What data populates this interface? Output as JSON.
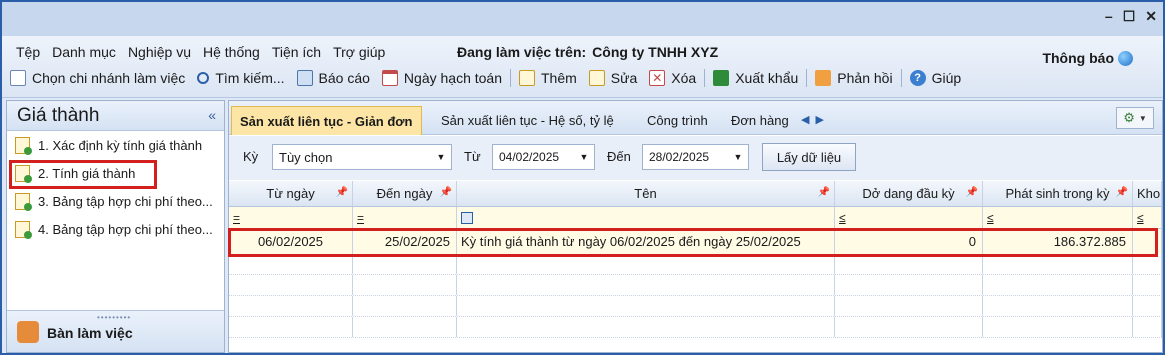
{
  "window": {
    "controls": [
      "–",
      "☐",
      "✕"
    ]
  },
  "menu": {
    "items": [
      "Tệp",
      "Danh mục",
      "Nghiệp vụ",
      "Hệ thống",
      "Tiện ích",
      "Trợ giúp"
    ],
    "working_on_label": "Đang làm việc trên:",
    "company": "Công ty TNHH XYZ",
    "notification": "Thông báo"
  },
  "toolbar": {
    "branch": "Chọn chi nhánh làm việc",
    "search": "Tìm kiếm...",
    "report": "Báo cáo",
    "accounting_date": "Ngày hạch toán",
    "add": "Thêm",
    "edit": "Sửa",
    "delete": "Xóa",
    "export": "Xuất khẩu",
    "feedback": "Phản hồi",
    "help": "Giúp"
  },
  "sidebar": {
    "title": "Giá thành",
    "collapse": "«",
    "items": [
      {
        "label": "1. Xác định kỳ tính giá thành"
      },
      {
        "label": "2. Tính giá thành"
      },
      {
        "label": "3. Bảng tập hợp chi phí theo..."
      },
      {
        "label": "4. Bảng tập hợp chi phí theo..."
      }
    ],
    "footer": "Bàn làm việc"
  },
  "tabs": [
    {
      "label": "Sản xuất liên tục - Giản đơn",
      "active": true
    },
    {
      "label": "Sản xuất liên tục - Hệ số, tỷ lệ",
      "active": false
    },
    {
      "label": "Công trình",
      "active": false
    },
    {
      "label": "Đơn hàng",
      "active": false
    }
  ],
  "filter": {
    "period_label": "Kỳ",
    "period_value": "Tùy chọn",
    "from_label": "Từ",
    "from_value": "04/02/2025",
    "to_label": "Đến",
    "to_value": "28/02/2025",
    "fetch_button": "Lấy dữ liệu"
  },
  "grid": {
    "columns": [
      "Từ ngày",
      "Đến ngày",
      "Tên",
      "Dở dang đầu kỳ",
      "Phát sinh trong kỳ",
      "Kho"
    ],
    "filter_ops": [
      "=",
      "=",
      "",
      "≤",
      "≤",
      "≤"
    ],
    "rows": [
      {
        "from": "06/02/2025",
        "to": "25/02/2025",
        "name": "Kỳ tính giá thành từ ngày 06/02/2025 đến ngày 25/02/2025",
        "wip_begin": "0",
        "incurred": "186.372.885",
        "stock": ""
      }
    ]
  },
  "colors": {
    "accent": "#2b5ea8",
    "highlight": "#d41f1f",
    "active_tab": "#fde6a5"
  }
}
